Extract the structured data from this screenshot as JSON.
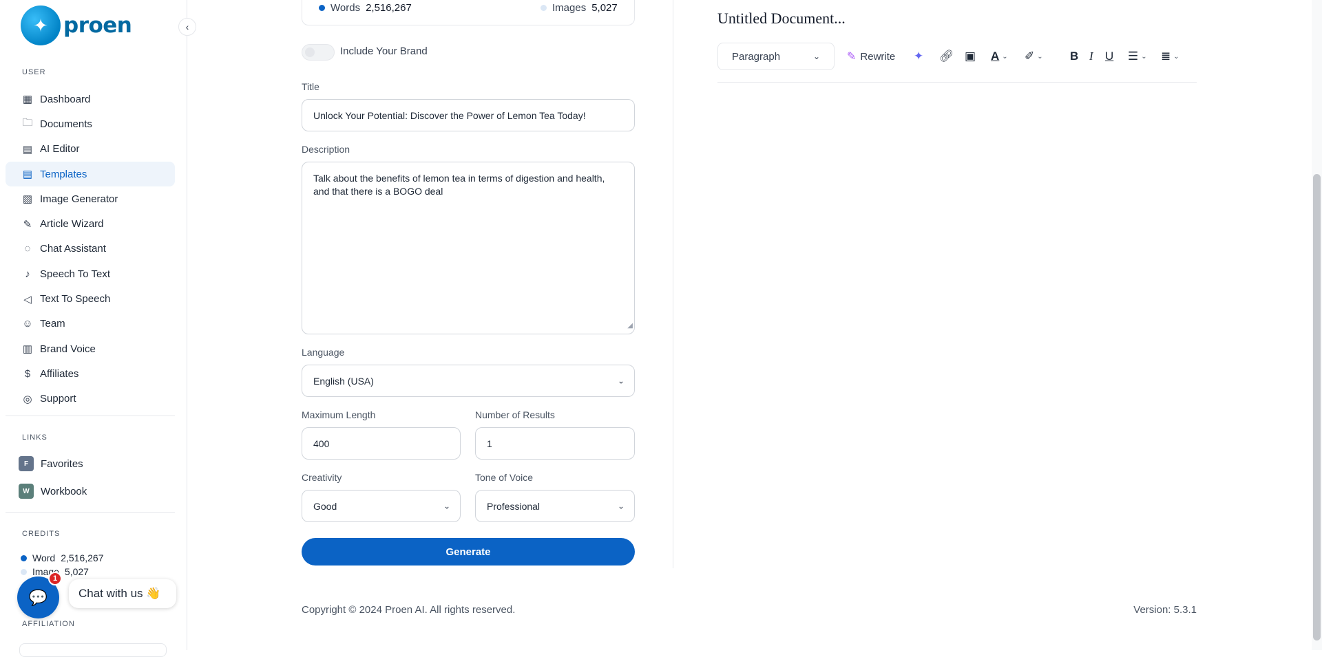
{
  "brand": {
    "name": "proen",
    "logo_glyph": "✦"
  },
  "sidebar": {
    "user_label": "USER",
    "items": [
      {
        "label": "Dashboard",
        "icon": "▦"
      },
      {
        "label": "Documents",
        "icon": "🗀"
      },
      {
        "label": "AI Editor",
        "icon": "▤"
      },
      {
        "label": "Templates",
        "icon": "▤"
      },
      {
        "label": "Image Generator",
        "icon": "▨"
      },
      {
        "label": "Article Wizard",
        "icon": "✎"
      },
      {
        "label": "Chat Assistant",
        "icon": "◌"
      },
      {
        "label": "Speech To Text",
        "icon": "♪"
      },
      {
        "label": "Text To Speech",
        "icon": "◁"
      },
      {
        "label": "Team",
        "icon": "☺"
      },
      {
        "label": "Brand Voice",
        "icon": "▥"
      },
      {
        "label": "Affiliates",
        "icon": "$"
      },
      {
        "label": "Support",
        "icon": "◎"
      }
    ],
    "links_label": "LINKS",
    "links": [
      {
        "badge": "F",
        "label": "Favorites"
      },
      {
        "badge": "W",
        "label": "Workbook"
      }
    ],
    "credits_label": "CREDITS",
    "credits": {
      "word_label": "Word",
      "word_value": "2,516,267",
      "image_label": "Image",
      "image_value": "5,027"
    },
    "affiliation_label": "AFFILIATION"
  },
  "chat": {
    "label": "Chat with us 👋",
    "count": "1",
    "icon": "💬"
  },
  "stats": {
    "words_label": "Words",
    "words_value": "2,516,267",
    "images_label": "Images",
    "images_value": "5,027"
  },
  "form": {
    "brand_toggle_label": "Include Your Brand",
    "title_label": "Title",
    "title_value": "Unlock Your Potential: Discover the Power of Lemon Tea Today!",
    "description_label": "Description",
    "description_value": "Talk about the benefits of lemon tea in terms of digestion and health, and that there is a BOGO deal",
    "language_label": "Language",
    "language_value": "English (USA)",
    "max_length_label": "Maximum Length",
    "max_length_value": "400",
    "results_label": "Number of Results",
    "results_value": "1",
    "creativity_label": "Creativity",
    "creativity_value": "Good",
    "tone_label": "Tone of Voice",
    "tone_value": "Professional",
    "generate_label": "Generate"
  },
  "editor": {
    "title": "Untitled Document...",
    "format_value": "Paragraph",
    "rewrite_label": "Rewrite"
  },
  "footer": {
    "copyright": "Copyright © 2024 Proen AI. All rights reserved.",
    "version": "Version: 5.3.1"
  }
}
